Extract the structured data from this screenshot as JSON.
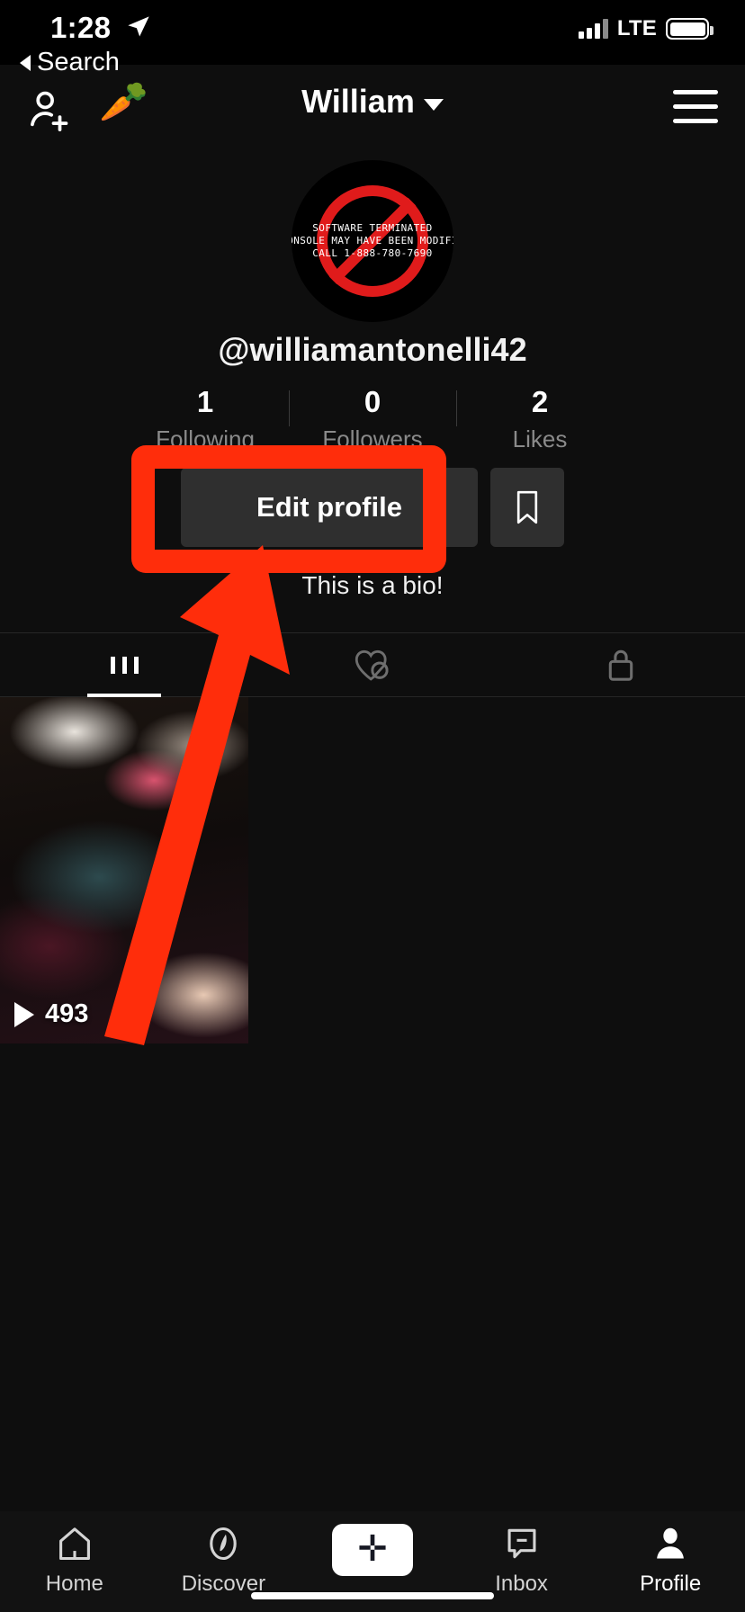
{
  "status_bar": {
    "time": "1:28",
    "location_icon": "location-arrow-icon",
    "carrier_label": "LTE",
    "signal_icon": "signal-bars-icon",
    "battery_icon": "battery-icon"
  },
  "back_link": {
    "label": "Search",
    "icon": "back-triangle-icon"
  },
  "nav": {
    "add_user_icon": "add-user-icon",
    "carrot_icon": "carrot-emoji-icon",
    "title": "William",
    "chevron_icon": "chevron-down-icon",
    "menu_icon": "hamburger-menu-icon"
  },
  "profile": {
    "avatar_lines": [
      "SOFTWARE TERMINATED",
      "CONSOLE MAY HAVE BEEN MODIFIE",
      "CALL 1-888-780-7690"
    ],
    "avatar_icon": "prohibition-sign-icon",
    "username": "@williamantonelli42",
    "bio": "This is a bio!",
    "stats": [
      {
        "value": "1",
        "label": "Following"
      },
      {
        "value": "0",
        "label": "Followers"
      },
      {
        "value": "2",
        "label": "Likes"
      }
    ],
    "edit_button": "Edit profile",
    "bookmark_icon": "bookmark-icon"
  },
  "annotation": {
    "highlight_color": "#ff2d0b",
    "target": "Edit profile",
    "box_icon": "highlight-rectangle",
    "arrow_icon": "arrow-up-icon"
  },
  "tabs": [
    {
      "name": "videos",
      "icon": "grid-icon",
      "active": true
    },
    {
      "name": "liked",
      "icon": "heart-slash-icon",
      "active": false
    },
    {
      "name": "private",
      "icon": "lock-icon",
      "active": false
    }
  ],
  "videos": [
    {
      "play_count": "493",
      "play_icon": "play-icon"
    }
  ],
  "bottom_nav": [
    {
      "label": "Home",
      "icon": "home-icon",
      "active": false
    },
    {
      "label": "Discover",
      "icon": "compass-icon",
      "active": false
    },
    {
      "label": "",
      "icon": "create-plus-icon",
      "active": false
    },
    {
      "label": "Inbox",
      "icon": "inbox-icon",
      "active": false
    },
    {
      "label": "Profile",
      "icon": "person-icon",
      "active": true
    }
  ],
  "colors": {
    "background": "#0e0e0e",
    "surface": "#2f2f2f",
    "accent_cyan": "#25f4ee",
    "accent_pink": "#fe2c55",
    "annotation_red": "#ff2d0b"
  }
}
